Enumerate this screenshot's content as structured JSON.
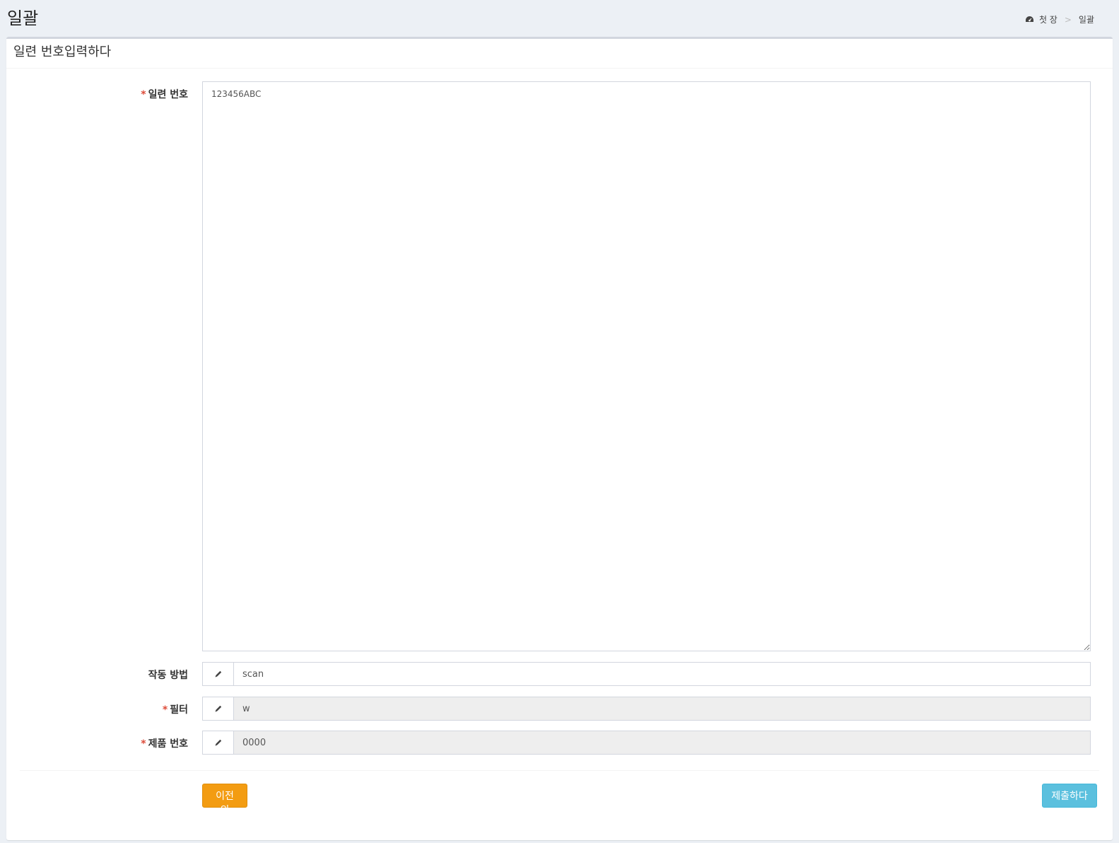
{
  "header": {
    "title": "일괄",
    "breadcrumb": [
      {
        "label": "첫 장",
        "icon": "dashboard-icon"
      },
      {
        "label": "일괄"
      }
    ],
    "breadcrumb_separator": ">"
  },
  "box": {
    "title": "일련 번호입력하다"
  },
  "form": {
    "serial": {
      "label": "일련 번호",
      "required": true,
      "value": "123456ABC"
    },
    "mode": {
      "label": "작동 방법",
      "required": false,
      "icon": "pencil-icon",
      "value": "scan"
    },
    "filter": {
      "label": "필터",
      "required": true,
      "icon": "pencil-icon",
      "value": "w",
      "readonly": true
    },
    "product": {
      "label": "제품 번호",
      "required": true,
      "icon": "pencil-icon",
      "value": "0000",
      "readonly": true
    },
    "required_marker": "*"
  },
  "actions": {
    "prev_label": "이전의",
    "submit_label": "제출하다"
  },
  "colors": {
    "prev_button": "#f39c12",
    "submit_button": "#5bc0de",
    "required": "#dd4b39"
  }
}
